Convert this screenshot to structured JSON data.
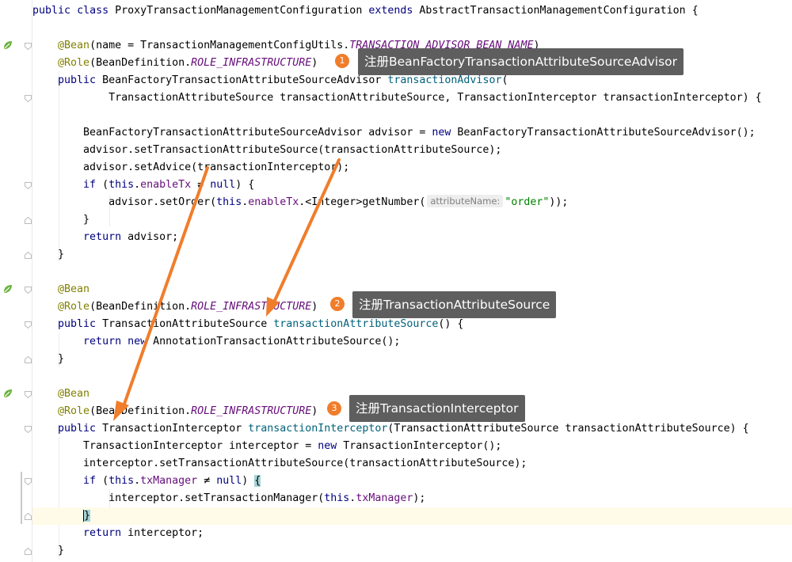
{
  "code": {
    "class_decl": {
      "kw1": "public",
      "kw2": "class",
      "name": "ProxyTransactionManagementConfiguration",
      "kw3": "extends",
      "parent": "AbstractTransactionManagementConfiguration",
      "brace": "{"
    },
    "m1": {
      "bean_ann": "@Bean",
      "bean_args_pre": "(name = TransactionManagementConfigUtils.",
      "bean_const": "TRANSACTION_ADVISOR_BEAN_NAME",
      "bean_args_post": ")",
      "role_ann": "@Role",
      "role_pre": "(BeanDefinition.",
      "role_const": "ROLE_INFRASTRUCTURE",
      "role_post": ")",
      "sig_kw": "public",
      "sig_type": "BeanFactoryTransactionAttributeSourceAdvisor",
      "sig_name": "transactionAdvisor",
      "sig_open": "(",
      "params": "TransactionAttributeSource transactionAttributeSource, TransactionInterceptor transactionInterceptor) {",
      "l1_pre": "BeanFactoryTransactionAttributeSourceAdvisor advisor = ",
      "l1_kw": "new",
      "l1_post": " BeanFactoryTransactionAttributeSourceAdvisor();",
      "l2": "advisor.setTransactionAttributeSource(transactionAttributeSource);",
      "l3": "advisor.setAdvice(transactionInterceptor);",
      "if_kw": "if",
      "if_open": " (",
      "this_kw": "this",
      "dot": ".",
      "field": "enableTx",
      "neq": " ≠ ",
      "null_kw": "null",
      "if_close": ") {",
      "l5_pre": "advisor.setOrder(",
      "l5_this": "this",
      "l5_dot": ".",
      "l5_field": "enableTx",
      "l5_mid": ".<Integer>getNumber(",
      "hint": "attributeName:",
      "l5_str": "\"order\"",
      "l5_end": "));",
      "close_brace": "}",
      "ret_kw": "return",
      "ret_val": " advisor;",
      "end_brace": "}"
    },
    "m2": {
      "bean_ann": "@Bean",
      "role_ann": "@Role",
      "role_pre": "(BeanDefinition.",
      "role_const": "ROLE_INFRASTRUCTURE",
      "role_post": ")",
      "sig_kw": "public",
      "sig_type": "TransactionAttributeSource",
      "sig_name": "transactionAttributeSource",
      "sig_tail": "() {",
      "ret_kw": "return",
      "new_kw": "new",
      "ret_val": " AnnotationTransactionAttributeSource();",
      "end_brace": "}"
    },
    "m3": {
      "bean_ann": "@Bean",
      "role_ann": "@Role",
      "role_pre": "(BeanDefinition.",
      "role_const": "ROLE_INFRASTRUCTURE",
      "role_post": ")",
      "sig_kw": "public",
      "sig_type": "TransactionInterceptor",
      "sig_name": "transactionInterceptor",
      "sig_tail": "(TransactionAttributeSource transactionAttributeSource) {",
      "l1_pre": "TransactionInterceptor interceptor = ",
      "l1_kw": "new",
      "l1_post": " TransactionInterceptor();",
      "l2": "interceptor.setTransactionAttributeSource(transactionAttributeSource);",
      "if_kw": "if",
      "if_open": " (",
      "this_kw": "this",
      "dot": ".",
      "field": "txManager",
      "neq": " ≠ ",
      "null_kw": "null",
      "if_close": ") ",
      "if_brace": "{",
      "l4_pre": "interceptor.setTransactionManager(",
      "l4_this": "this",
      "l4_dot": ".",
      "l4_field": "txManager",
      "l4_end": ");",
      "close_brace": "}",
      "ret_kw": "return",
      "ret_val": " interceptor;",
      "end_brace": "}"
    }
  },
  "callouts": [
    {
      "num": "1",
      "text": "注册BeanFactoryTransactionAttributeSourceAdvisor"
    },
    {
      "num": "2",
      "text": "注册TransactionAttributeSource"
    },
    {
      "num": "3",
      "text": "注册TransactionInterceptor"
    }
  ],
  "colors": {
    "arrow": "#f07d2b",
    "callout_bg": "#5e5e5e",
    "badge": "#f07d2b",
    "keyword": "#000080",
    "annotation": "#808000"
  },
  "icons": {
    "gutter": "spring-bean-icon",
    "fold": "fold-marker-icon"
  }
}
